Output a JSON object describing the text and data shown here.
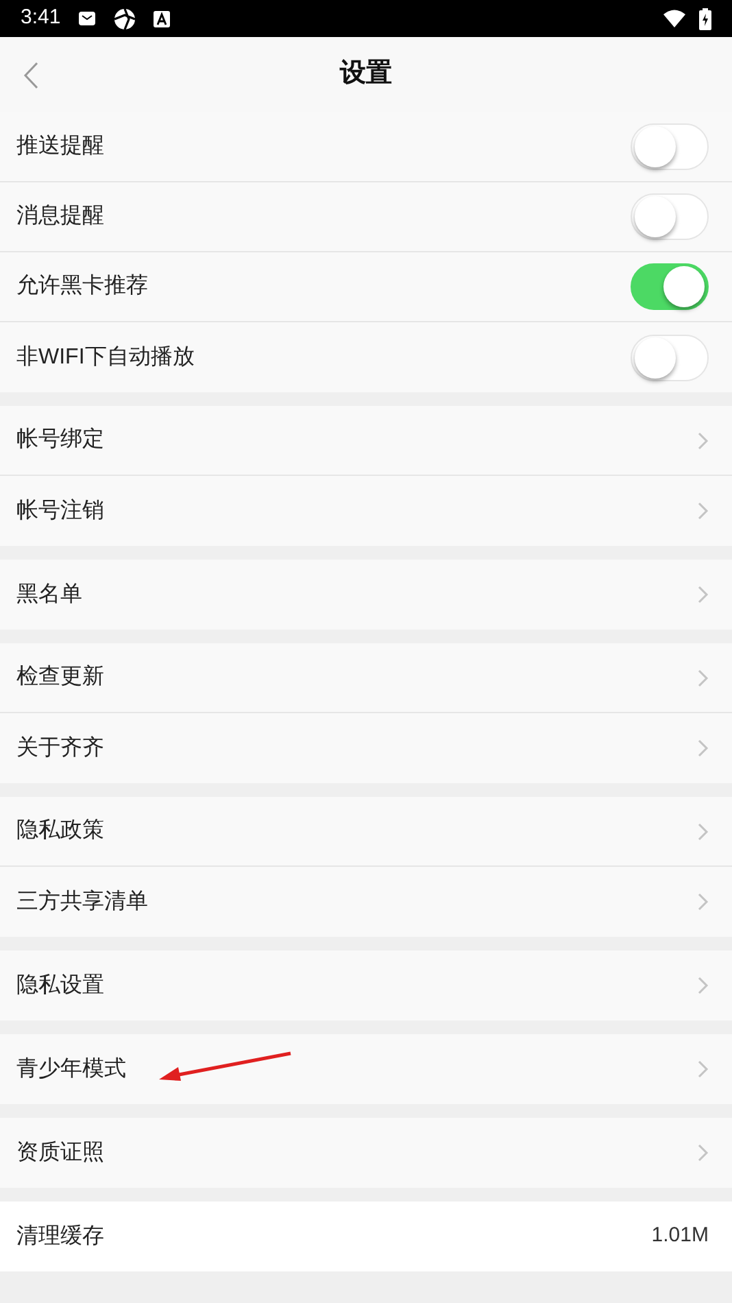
{
  "status_bar": {
    "time": "3:41"
  },
  "header": {
    "title": "设置"
  },
  "groups": [
    {
      "items": [
        {
          "kind": "toggle",
          "label": "推送提醒",
          "on": false
        },
        {
          "kind": "toggle",
          "label": "消息提醒",
          "on": false
        },
        {
          "kind": "toggle",
          "label": "允许黑卡推荐",
          "on": true
        },
        {
          "kind": "toggle",
          "label": "非WIFI下自动播放",
          "on": false
        }
      ]
    },
    {
      "items": [
        {
          "kind": "link",
          "label": "帐号绑定"
        },
        {
          "kind": "link",
          "label": "帐号注销"
        }
      ]
    },
    {
      "items": [
        {
          "kind": "link",
          "label": "黑名单"
        }
      ]
    },
    {
      "items": [
        {
          "kind": "link",
          "label": "检查更新"
        },
        {
          "kind": "link",
          "label": "关于齐齐"
        }
      ]
    },
    {
      "items": [
        {
          "kind": "link",
          "label": "隐私政策"
        },
        {
          "kind": "link",
          "label": "三方共享清单"
        }
      ]
    },
    {
      "items": [
        {
          "kind": "link",
          "label": "隐私设置"
        }
      ]
    },
    {
      "items": [
        {
          "kind": "link",
          "label": "青少年模式",
          "annotated": true
        }
      ]
    },
    {
      "items": [
        {
          "kind": "link",
          "label": "资质证照"
        }
      ]
    },
    {
      "items": [
        {
          "kind": "value",
          "label": "清理缓存",
          "value": "1.01M"
        }
      ]
    }
  ]
}
